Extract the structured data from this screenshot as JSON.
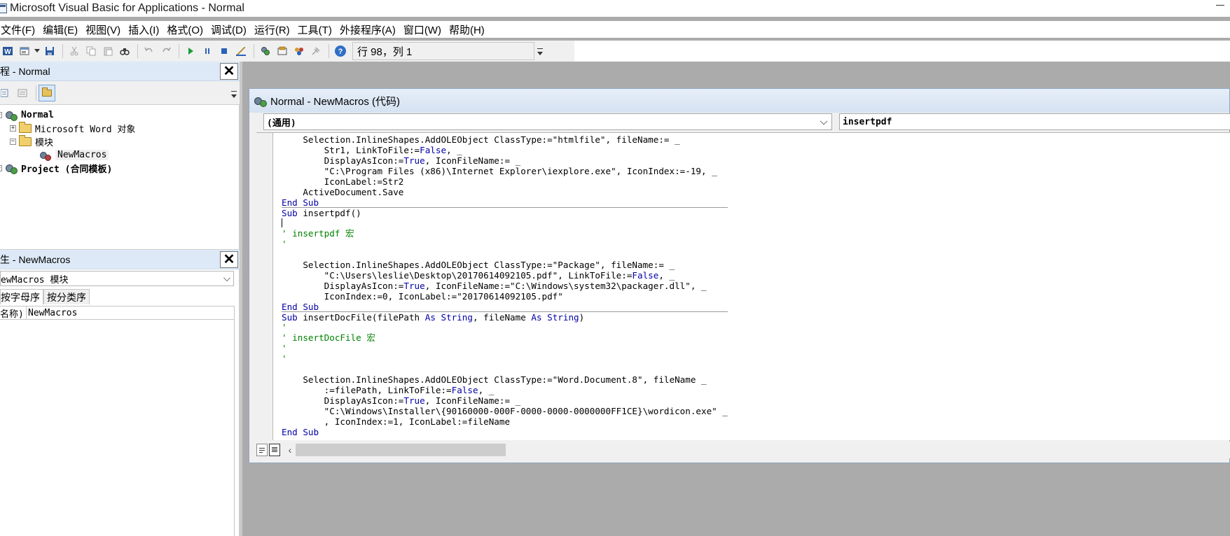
{
  "window": {
    "title": "Microsoft Visual Basic for Applications - Normal"
  },
  "menu": [
    "文件(F)",
    "编辑(E)",
    "视图(V)",
    "插入(I)",
    "格式(O)",
    "调试(D)",
    "运行(R)",
    "工具(T)",
    "外接程序(A)",
    "窗口(W)",
    "帮助(H)"
  ],
  "toolbar": {
    "status": "行 98，列 1"
  },
  "project_panel": {
    "title": "程 - Normal",
    "close_label": "✕",
    "tree": [
      {
        "label": "Normal",
        "bold": true
      },
      {
        "label": "Microsoft Word 对象",
        "bold": false
      },
      {
        "label": "模块",
        "bold": false
      },
      {
        "label": "NewMacros",
        "bold": false
      },
      {
        "label": "Project (合同模板)",
        "bold": true
      }
    ]
  },
  "properties_panel": {
    "title": "生 - NewMacros",
    "close_label": "✕",
    "object_select": "ewMacros 模块",
    "tabs": [
      "按字母序",
      "按分类序"
    ],
    "row": {
      "name": "名称)",
      "value": "NewMacros"
    }
  },
  "code_window": {
    "title": "Normal - NewMacros (代码)",
    "object_combo": "(通用)",
    "procedure_combo": "insertpdf",
    "lines": [
      [
        {
          "t": "    Selection.InlineShapes.AddOLEObject ClassType:=\"htmlfile\", fileName:= _",
          "c": ""
        }
      ],
      [
        {
          "t": "        Str1, LinkToFile:=",
          "c": ""
        },
        {
          "t": "False",
          "c": "kw"
        },
        {
          "t": ", _",
          "c": ""
        }
      ],
      [
        {
          "t": "        DisplayAsIcon:=",
          "c": ""
        },
        {
          "t": "True",
          "c": "kw"
        },
        {
          "t": ", IconFileName:= _",
          "c": ""
        }
      ],
      [
        {
          "t": "        \"C:\\Program Files (x86)\\Internet Explorer\\iexplore.exe\", IconIndex:=-19, _",
          "c": ""
        }
      ],
      [
        {
          "t": "        IconLabel:=Str2",
          "c": ""
        }
      ],
      [
        {
          "t": "    ActiveDocument.Save",
          "c": ""
        }
      ],
      [
        {
          "t": "End Sub",
          "c": "kw"
        }
      ],
      [
        {
          "t": "Sub",
          "c": "kw"
        },
        {
          "t": " insertpdf()",
          "c": ""
        }
      ],
      [
        {
          "t": "",
          "c": "caret"
        }
      ],
      [
        {
          "t": "' insertpdf 宏",
          "c": "cm"
        }
      ],
      [
        {
          "t": "'",
          "c": "cm"
        }
      ],
      [
        {
          "t": "",
          "c": ""
        }
      ],
      [
        {
          "t": "    Selection.InlineShapes.AddOLEObject ClassType:=\"Package\", fileName:= _",
          "c": ""
        }
      ],
      [
        {
          "t": "        \"C:\\Users\\leslie\\Desktop\\20170614092105.pdf\", LinkToFile:=",
          "c": ""
        },
        {
          "t": "False",
          "c": "kw"
        },
        {
          "t": ", _",
          "c": ""
        }
      ],
      [
        {
          "t": "        DisplayAsIcon:=",
          "c": ""
        },
        {
          "t": "True",
          "c": "kw"
        },
        {
          "t": ", IconFileName:=\"C:\\Windows\\system32\\packager.dll\", _",
          "c": ""
        }
      ],
      [
        {
          "t": "        IconIndex:=0, IconLabel:=\"20170614092105.pdf\"",
          "c": ""
        }
      ],
      [
        {
          "t": "End Sub",
          "c": "kw"
        }
      ],
      [
        {
          "t": "Sub",
          "c": "kw"
        },
        {
          "t": " insertDocFile(filePath ",
          "c": ""
        },
        {
          "t": "As String",
          "c": "kw"
        },
        {
          "t": ", fileName ",
          "c": ""
        },
        {
          "t": "As String",
          "c": "kw"
        },
        {
          "t": ")",
          "c": ""
        }
      ],
      [
        {
          "t": "'",
          "c": "cm"
        }
      ],
      [
        {
          "t": "' insertDocFile 宏",
          "c": "cm"
        }
      ],
      [
        {
          "t": "'",
          "c": "cm"
        }
      ],
      [
        {
          "t": "'",
          "c": "cm"
        }
      ],
      [
        {
          "t": "",
          "c": ""
        }
      ],
      [
        {
          "t": "    Selection.InlineShapes.AddOLEObject ClassType:=\"Word.Document.8\", fileName _",
          "c": ""
        }
      ],
      [
        {
          "t": "        :=filePath, LinkToFile:=",
          "c": ""
        },
        {
          "t": "False",
          "c": "kw"
        },
        {
          "t": ", _",
          "c": ""
        }
      ],
      [
        {
          "t": "        DisplayAsIcon:=",
          "c": ""
        },
        {
          "t": "True",
          "c": "kw"
        },
        {
          "t": ", IconFileName:= _",
          "c": ""
        }
      ],
      [
        {
          "t": "        \"C:\\Windows\\Installer\\{90160000-000F-0000-0000-0000000FF1CE}\\wordicon.exe\" _",
          "c": ""
        }
      ],
      [
        {
          "t": "        , IconIndex:=1, IconLabel:=fileName",
          "c": ""
        }
      ],
      [
        {
          "t": "End Sub",
          "c": "kw"
        }
      ]
    ]
  },
  "colors": {
    "keyword": "#0000a8",
    "comment": "#008000",
    "panel_title_bg": "#dde9f6",
    "mdi_bg": "#ababab"
  }
}
